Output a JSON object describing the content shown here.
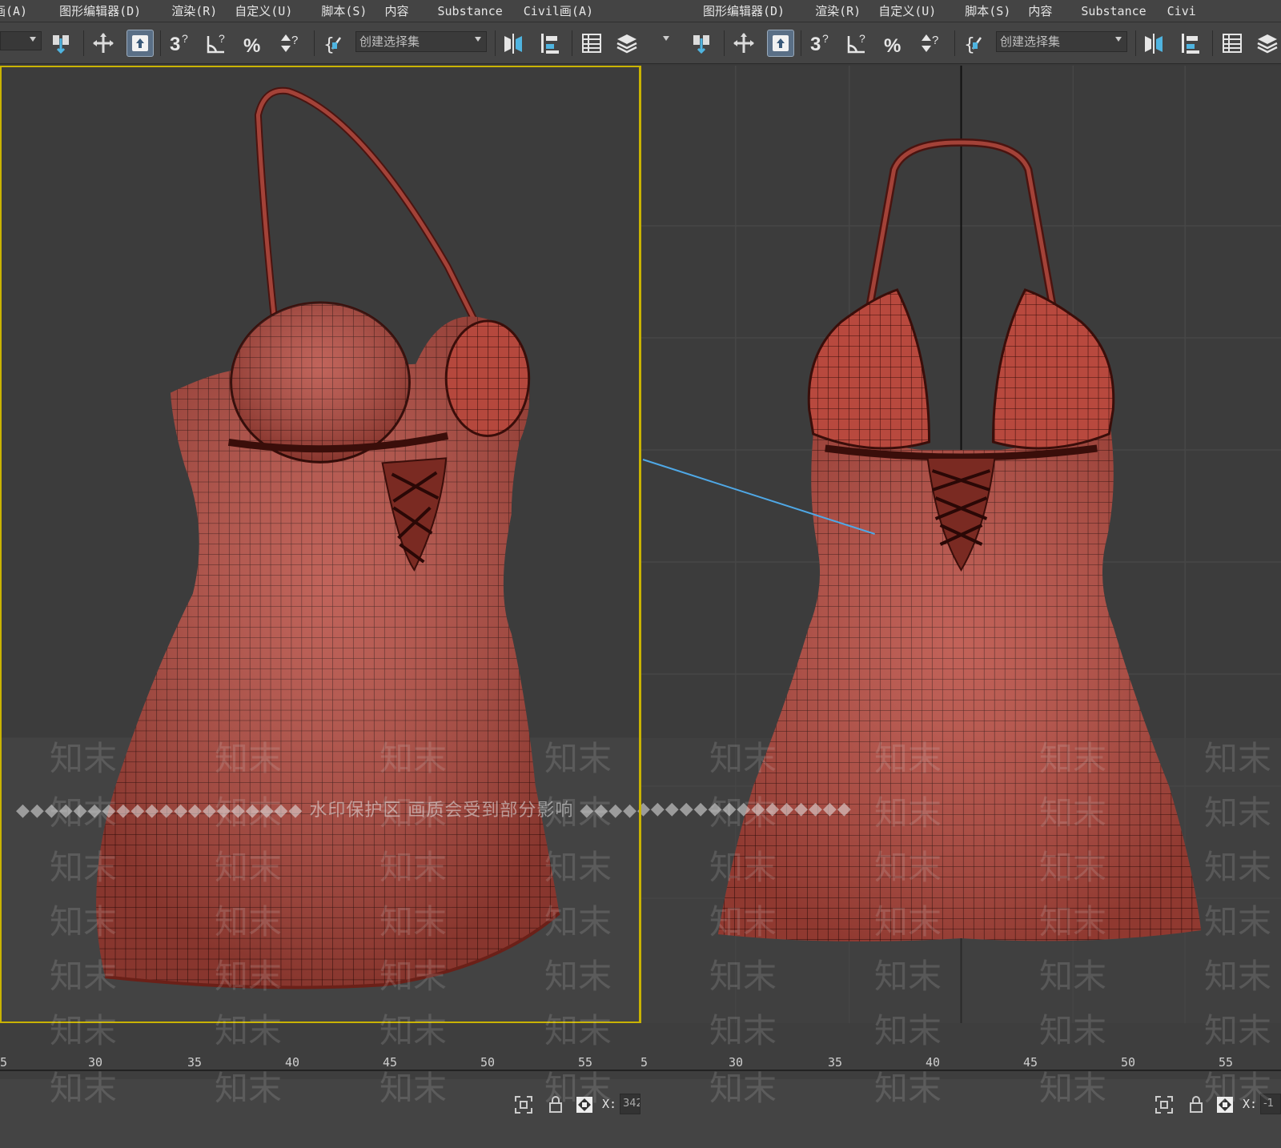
{
  "menus": {
    "left": [
      "画(A)",
      "图形编辑器(D)",
      "渲染(R)",
      "自定义(U)",
      "脚本(S)",
      "内容",
      "Substance",
      "Civil画(A)"
    ],
    "right": [
      "图形编辑器(D)",
      "渲染(R)",
      "自定义(U)",
      "脚本(S)",
      "内容",
      "Substance",
      "Civi"
    ]
  },
  "toolbar": {
    "selection_set_placeholder": "创建选择集",
    "icons": [
      "select-link-icon",
      "move-icon",
      "select-object-icon",
      "snap-3d-icon",
      "angle-snap-icon",
      "percent-snap-icon",
      "spinner-snap-icon",
      "named-selection-icon",
      "mirror-icon",
      "align-icon",
      "scene-explorer-icon",
      "layer-icon"
    ]
  },
  "watermark": {
    "banner": "◆◆◆◆◆◆◆◆◆◆◆◆◆◆◆◆◆◆◆◆ 水印保护区   画质会受到部分影响 ◆◆◆◆◆◆◆◆◆◆◆◆◆◆◆◆◆◆◆◆",
    "tile": "知末"
  },
  "timeline": {
    "left_ticks": [
      "5",
      "30",
      "35",
      "40",
      "45",
      "50",
      "55"
    ],
    "right_ticks": [
      "5",
      "30",
      "35",
      "40",
      "45",
      "50",
      "55"
    ]
  },
  "status": {
    "x_label": "X:",
    "left_x_value": "342",
    "right_x_value": "-1"
  },
  "colors": {
    "ui_bg": "#444444",
    "viewport_bg": "#3c3c3c",
    "active_border": "#c9b300",
    "garment": "#b54a3e",
    "wire": "#3a0e0a"
  }
}
